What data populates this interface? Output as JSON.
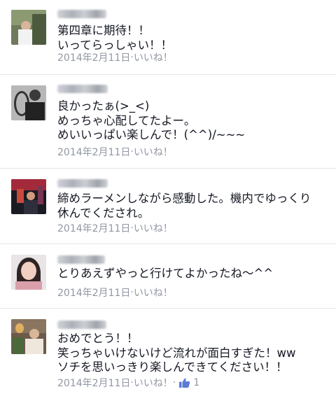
{
  "comments": [
    {
      "text": "第四章に期待！！\nいってらっしゃい！！",
      "date": "2014年2月11日",
      "separator": " · ",
      "like_label": "いいね！"
    },
    {
      "text": "良かったぁ(>_<)\nめっちゃ心配してたよー。\nめいいっぱい楽しんで！(^^)/~~~",
      "date": "2014年2月11日",
      "separator": " · ",
      "like_label": "いいね！"
    },
    {
      "text": "締めラーメンしながら感動した。機内でゆっくり\n休んでくだされ。",
      "date": "2014年2月11日",
      "separator": " · ",
      "like_label": "いいね！"
    },
    {
      "text": "とりあえずやっと行けてよかったね〜^^",
      "date": "2014年2月11日",
      "separator": " · ",
      "like_label": "いいね！"
    },
    {
      "text": "おめでとう！！\n笑っちゃいけないけど流れが面白すぎた！ww\nソチを思いっきり楽しんできてください！！",
      "date": "2014年2月11日",
      "separator": " · ",
      "like_label": "いいね！",
      "separator2": " · ",
      "like_count": "1"
    }
  ],
  "colors": {
    "text": "#141823",
    "meta": "#9197a3",
    "divider": "#e3e5e8",
    "like_thumb": "#5b7bd5"
  },
  "icons": {
    "like": "thumbs-up-icon"
  }
}
